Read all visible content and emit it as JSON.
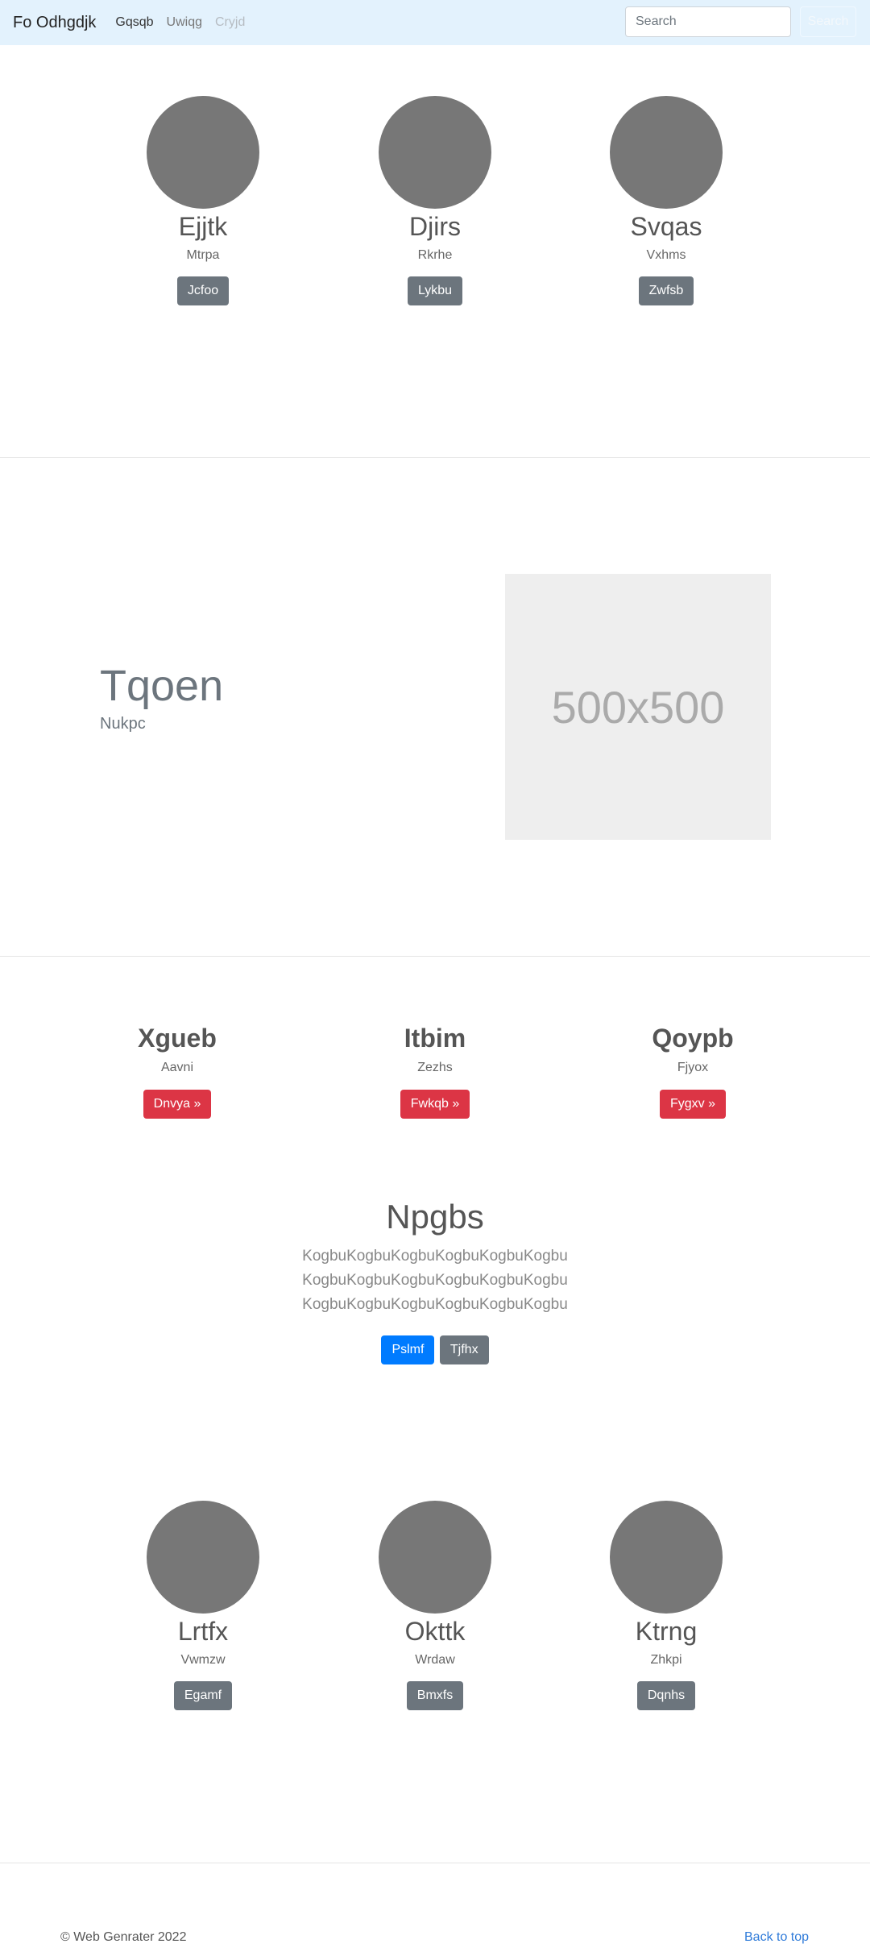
{
  "navbar": {
    "brand": "Fo Odhgdjk",
    "links": [
      "Gqsqb",
      "Uwiqg",
      "Cryjd"
    ],
    "search_placeholder": "Search",
    "search_button": "Search"
  },
  "team_top": [
    {
      "name": "Ejjtk",
      "role": "Mtrpa",
      "button": "Jcfoo"
    },
    {
      "name": "Djirs",
      "role": "Rkrhe",
      "button": "Lykbu"
    },
    {
      "name": "Svqas",
      "role": "Vxhms",
      "button": "Zwfsb"
    }
  ],
  "hero": {
    "title": "Tqoen",
    "subtitle": "Nukpc",
    "image_label": "500x500"
  },
  "features": [
    {
      "title": "Xgueb",
      "subtitle": "Aavni",
      "button": "Dnvya »"
    },
    {
      "title": "Itbim",
      "subtitle": "Zezhs",
      "button": "Fwkqb »"
    },
    {
      "title": "Qoypb",
      "subtitle": "Fjyox",
      "button": "Fygxv »"
    }
  ],
  "jumbotron": {
    "title": "Npgbs",
    "lines": [
      "KogbuKogbuKogbuKogbuKogbuKogbu",
      "KogbuKogbuKogbuKogbuKogbuKogbu",
      "KogbuKogbuKogbuKogbuKogbuKogbu"
    ],
    "primary_button": "Pslmf",
    "secondary_button": "Tjfhx"
  },
  "team_bottom": [
    {
      "name": "Lrtfx",
      "role": "Vwmzw",
      "button": "Egamf"
    },
    {
      "name": "Okttk",
      "role": "Wrdaw",
      "button": "Bmxfs"
    },
    {
      "name": "Ktrng",
      "role": "Zhkpi",
      "button": "Dqnhs"
    }
  ],
  "footer": {
    "copyright": "© Web Genrater 2022",
    "back_to_top": "Back to top"
  }
}
